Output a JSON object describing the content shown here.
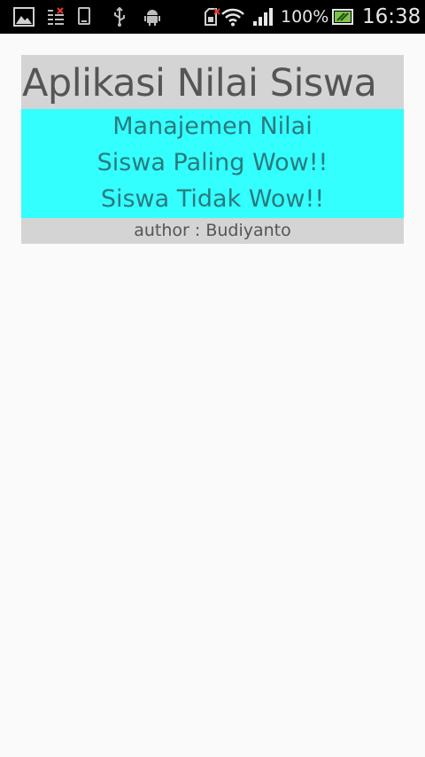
{
  "status_bar": {
    "icons_left": [
      "gallery-icon",
      "sync-error-icon",
      "phone-icon",
      "usb-icon",
      "android-debug-icon"
    ],
    "icons_right": [
      "sim-error-icon",
      "wifi-icon",
      "signal-icon",
      "battery-charging-icon"
    ],
    "battery_percent": "100%",
    "time": "16:38"
  },
  "app": {
    "title": "Aplikasi Nilai Siswa",
    "menu": [
      {
        "label": "Manajemen Nilai"
      },
      {
        "label": "Siswa Paling Wow!!"
      },
      {
        "label": "Siswa Tidak Wow!!"
      }
    ],
    "author": "author : Budiyanto",
    "colors": {
      "title_bg": "#d4d4d4",
      "menu_bg": "#33ffff",
      "menu_text": "#2a7a7e",
      "text_gray": "#555555"
    }
  }
}
